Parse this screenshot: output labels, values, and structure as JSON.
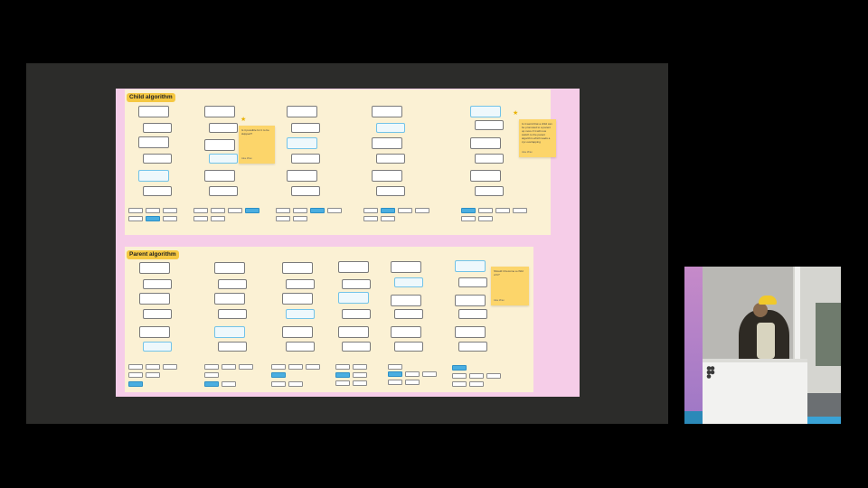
{
  "canvas": {
    "child_label": "Child algorithm",
    "parent_label": "Parent algorithm",
    "sticky_child_1": "Is it possible for it to be skipped?",
    "sticky_child_1_author": "Jake Zhao",
    "sticky_child_2": "Is it weird that a child can be promoted to a parent up more if it will now switch to the parent algorithm which leads a cyc overlapping",
    "sticky_child_2_author": "Jake Zhao",
    "sticky_parent_1": "Should it become a child of b?",
    "sticky_parent_1_author": "Jake Zhao"
  },
  "colors": {
    "slide_bg": "#2c2c2a",
    "canvas_pink": "#f6cde8",
    "section_bg": "#fbf1d4",
    "label_yellow": "#f5c842",
    "selected_blue": "#4aaee0",
    "sticky_yellow": "#fcd56a"
  },
  "icons": [
    "star-icon",
    "figma-logo-icon"
  ]
}
